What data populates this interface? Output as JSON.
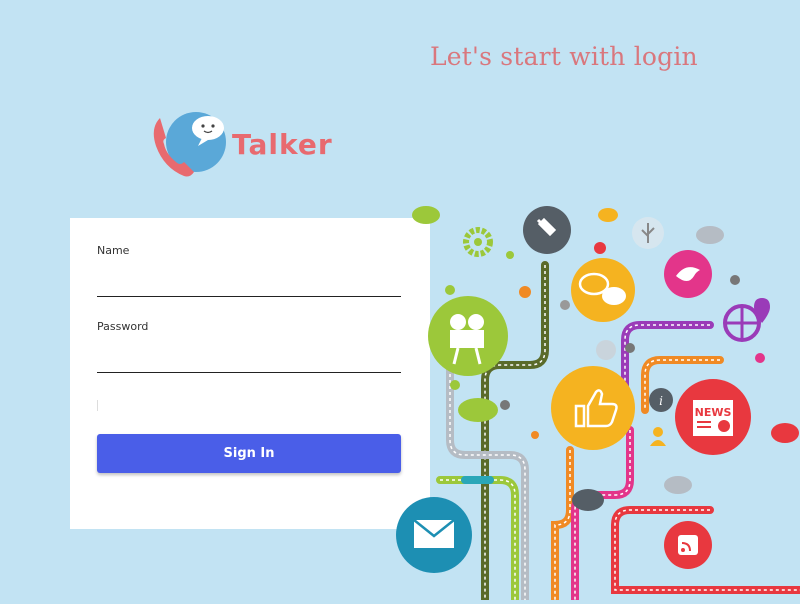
{
  "page": {
    "headline": "Let's start with login"
  },
  "logo": {
    "text": "Talker",
    "icon": "phone-chat-logo-icon"
  },
  "form": {
    "name_label": "Name",
    "name_value": "",
    "password_label": "Password",
    "password_value": "",
    "signin_label": "Sign In"
  },
  "illustration": {
    "news_badge": "NEWS",
    "icons": [
      "map-pin-icon",
      "chat-bubbles-icon",
      "bird-icon",
      "globe-location-icon",
      "video-camera-icon",
      "thumbs-up-icon",
      "news-icon",
      "info-icon",
      "mail-icon",
      "rss-icon",
      "usb-icon",
      "gear-icon",
      "cloud-icon",
      "person-icon"
    ]
  },
  "colors": {
    "background": "#c2e3f3",
    "accent_button": "#4a5ee8",
    "brand": "#e86a6f",
    "headline": "#d9777d"
  }
}
